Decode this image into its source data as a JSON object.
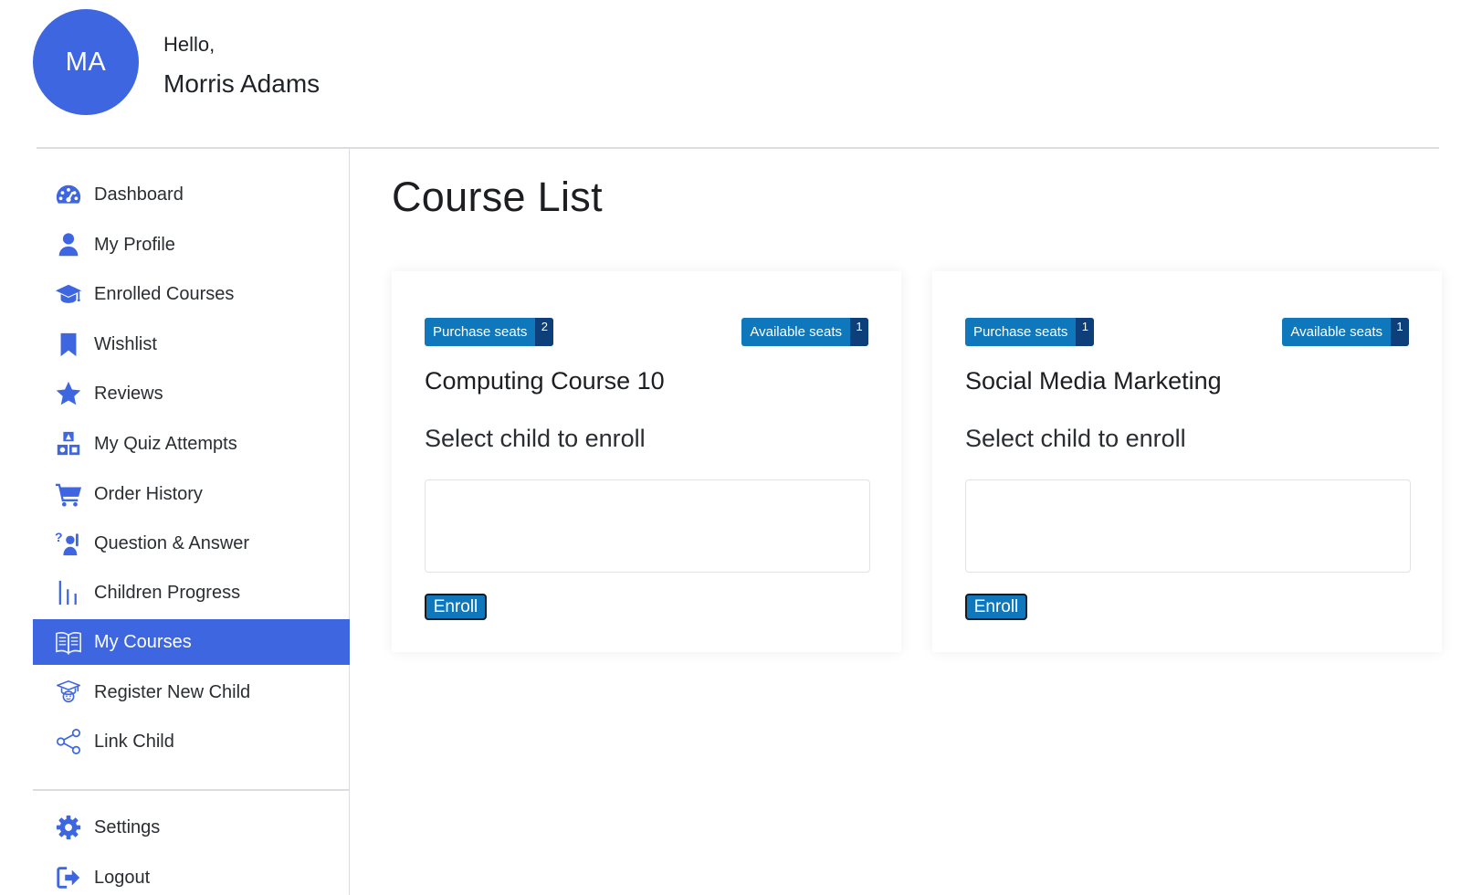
{
  "user": {
    "initials": "MA",
    "greeting": "Hello,",
    "name": "Morris Adams"
  },
  "sidebar": {
    "items": [
      {
        "label": "Dashboard",
        "icon": "dashboard-gauge-icon"
      },
      {
        "label": "My Profile",
        "icon": "user-icon"
      },
      {
        "label": "Enrolled Courses",
        "icon": "graduation-cap-icon"
      },
      {
        "label": "Wishlist",
        "icon": "bookmark-icon"
      },
      {
        "label": "Reviews",
        "icon": "star-icon"
      },
      {
        "label": "My Quiz Attempts",
        "icon": "quiz-shapes-icon"
      },
      {
        "label": "Order History",
        "icon": "cart-icon"
      },
      {
        "label": "Question & Answer",
        "icon": "question-person-icon"
      },
      {
        "label": "Children Progress",
        "icon": "bars-icon"
      },
      {
        "label": "My Courses",
        "icon": "open-book-icon",
        "active": true
      },
      {
        "label": "Register New Child",
        "icon": "graduate-child-icon"
      },
      {
        "label": "Link Child",
        "icon": "share-icon"
      }
    ],
    "footer_items": [
      {
        "label": "Settings",
        "icon": "gear-icon"
      },
      {
        "label": "Logout",
        "icon": "logout-icon"
      }
    ]
  },
  "main": {
    "title": "Course List",
    "courses": [
      {
        "purchase_label": "Purchase seats",
        "purchase_count": "2",
        "available_label": "Available seats",
        "available_count": "1",
        "title": "Computing Course 10",
        "select_label": "Select child to enroll",
        "enroll_label": "Enroll"
      },
      {
        "purchase_label": "Purchase seats",
        "purchase_count": "1",
        "available_label": "Available seats",
        "available_count": "1",
        "title": "Social Media Marketing",
        "select_label": "Select child to enroll",
        "enroll_label": "Enroll"
      }
    ]
  },
  "colors": {
    "accent": "#3d66e0",
    "badge": "#0f78bd",
    "badge_count": "#0d3f7a"
  }
}
